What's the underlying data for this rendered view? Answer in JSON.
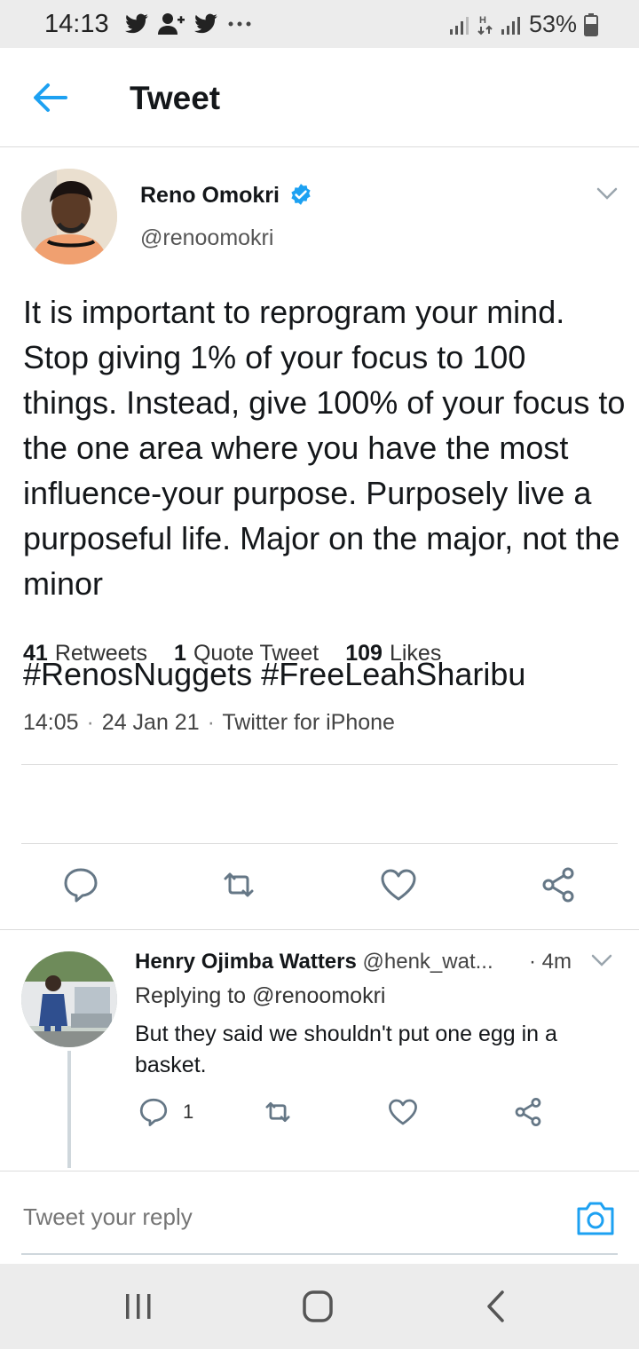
{
  "status_bar": {
    "time": "14:13",
    "battery": "53%",
    "notification_icons": [
      "twitter-icon",
      "add-user-icon",
      "twitter-icon",
      "more-icon"
    ]
  },
  "header": {
    "title": "Tweet"
  },
  "tweet": {
    "author_name": "Reno Omokri",
    "author_handle": "@renoomokri",
    "verified": true,
    "text": "It is important to reprogram your mind. Stop giving 1% of your focus to 100 things. Instead, give 100% of your focus to the one area where you have the most influence-your purpose. Purposely live a purposeful life. Major on the major, not the minor\n\n#RenosNuggets #FreeLeahSharibu",
    "time": "14:05",
    "date": "24 Jan 21",
    "source": "Twitter for iPhone",
    "stats": {
      "retweets_count": "41",
      "retweets_label": "Retweets",
      "quotes_count": "1",
      "quotes_label": "Quote Tweet",
      "likes_count": "109",
      "likes_label": "Likes"
    }
  },
  "reply": {
    "author_name": "Henry Ojimba Watters",
    "author_handle": "@henk_wat...",
    "time": "· 4m",
    "replying_to": "Replying to @renoomokri",
    "text": "But they said we shouldn't put one egg in a basket.",
    "reply_count": "1"
  },
  "composer": {
    "placeholder": "Tweet your reply"
  },
  "colors": {
    "accent": "#1da1f2",
    "text": "#14171a",
    "icon_gray": "#657786"
  }
}
